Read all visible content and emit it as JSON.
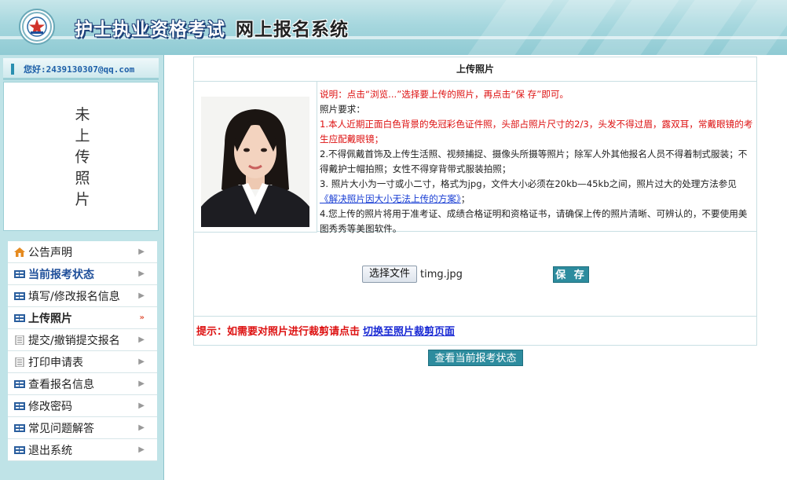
{
  "header": {
    "title_main": "护士执业资格考试",
    "title_sub": "网上报名系统",
    "logo_icon": "exam-emblem-icon"
  },
  "sidebar": {
    "greeting": "您好:2439130307@qq.com",
    "photo_placeholder": "未上传照片",
    "menu": [
      {
        "label": "公告声明",
        "icon": "home-icon"
      },
      {
        "label": "当前报考状态",
        "icon": "list-icon"
      },
      {
        "label": "填写/修改报名信息",
        "icon": "list-icon"
      },
      {
        "label": "上传照片",
        "icon": "list-icon"
      },
      {
        "label": "提交/撤销提交报名",
        "icon": "document-icon"
      },
      {
        "label": "打印申请表",
        "icon": "document-icon"
      },
      {
        "label": "查看报名信息",
        "icon": "list-icon"
      },
      {
        "label": "修改密码",
        "icon": "list-icon"
      },
      {
        "label": "常见问题解答",
        "icon": "list-icon"
      },
      {
        "label": "退出系统",
        "icon": "list-icon"
      }
    ]
  },
  "main": {
    "panel_title": "上传照片",
    "notes": {
      "line1": "说明：点击“浏览...”选择要上传的照片，再点击“保 存”即可。",
      "line2": "照片要求：",
      "line3": "1.本人近期正面白色背景的免冠彩色证件照，头部占照片尺寸的2/3，头发不得过眉，露双耳，常戴眼镜的考生应配戴眼镜；",
      "line4": "2.不得佩戴首饰及上传生活照、视频捕捉、摄像头所摄等照片；除军人外其他报名人员不得着制式服装；不得戴护士帽拍照；女性不得穿背带式服装拍照；",
      "line5_a": "3. 照片大小为一寸或小二寸，格式为jpg，文件大小必须在20kb—45kb之间，照片过大的处理方法参见",
      "line5_link": "《解决照片因大小无法上传的方案》",
      "line5_b": "；",
      "line6": "4.您上传的照片将用于准考证、成绩合格证明和资格证书，请确保上传的照片清晰、可辨认的，不要使用美图秀秀等美图软件。"
    },
    "file_button": "选择文件",
    "file_name": "timg.jpg",
    "save_button": "保 存",
    "tip_text": "提示：如需要对照片进行裁剪请点击",
    "tip_link": "切换至照片裁剪页面",
    "status_button": "查看当前报考状态"
  }
}
